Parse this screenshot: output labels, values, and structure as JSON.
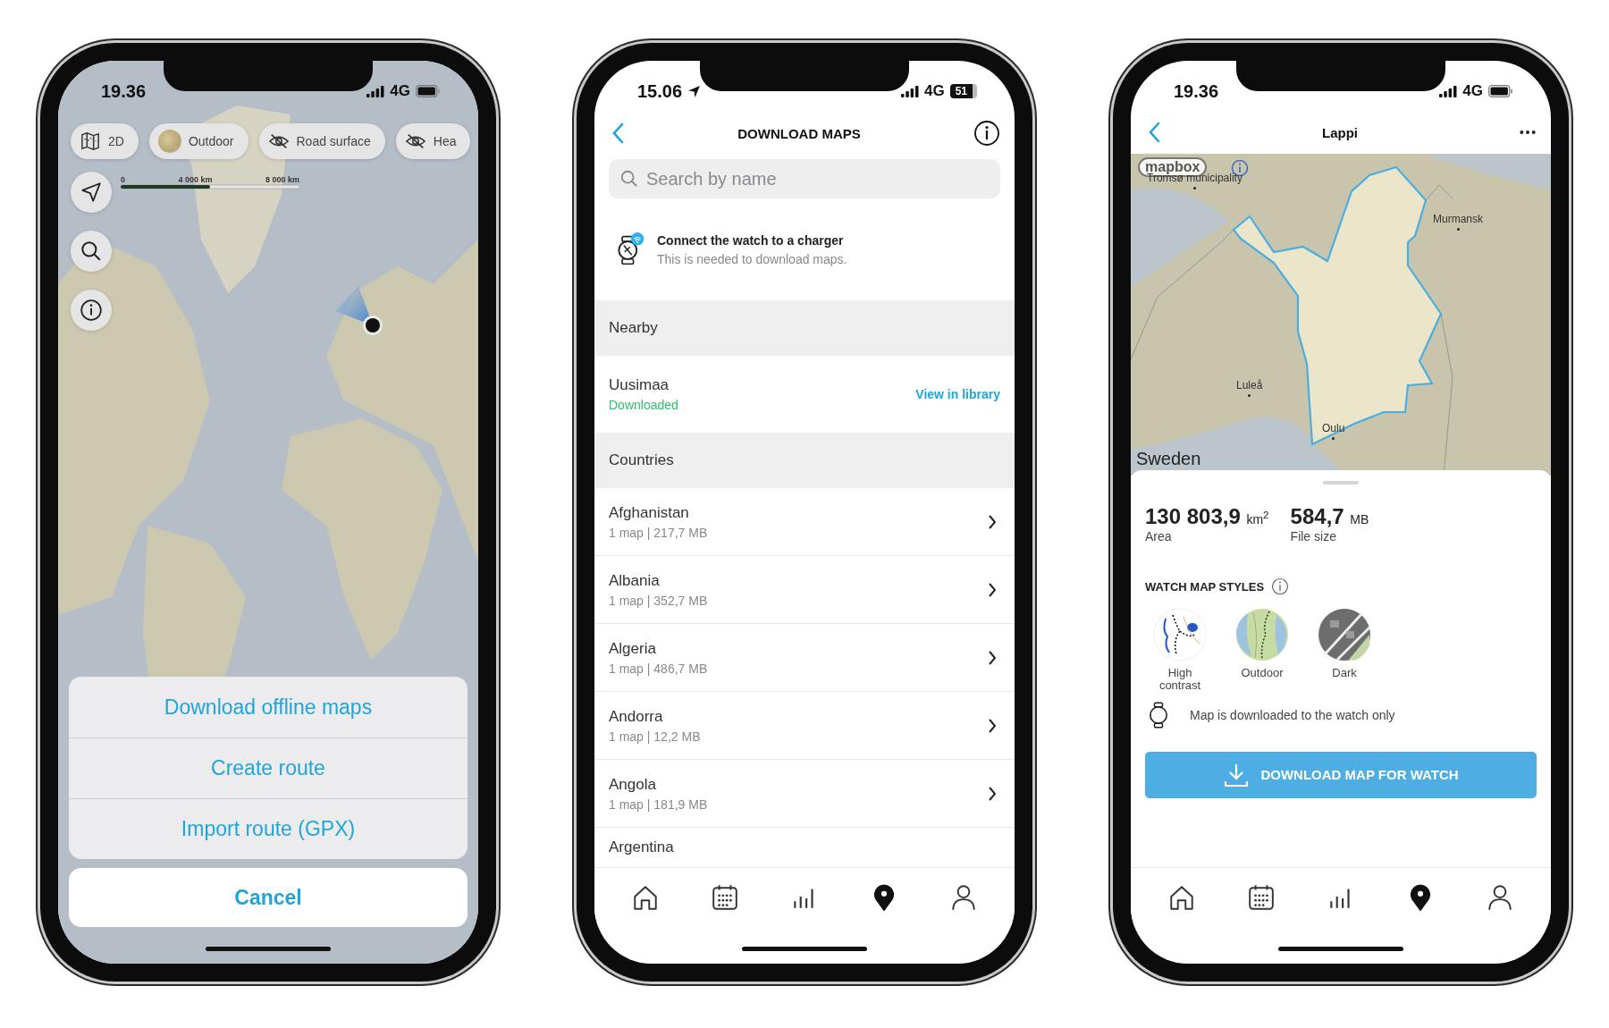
{
  "map_screen": {
    "status_bar": {
      "time": "19.36",
      "network": "4G"
    },
    "chips": [
      {
        "kind": "map",
        "label": "2D"
      },
      {
        "kind": "style",
        "label": "Outdoor"
      },
      {
        "kind": "hidden",
        "label": "Road surface"
      },
      {
        "kind": "hidden",
        "label": "Hea"
      }
    ],
    "scale_bar": {
      "labels": [
        "0",
        "4 000 km",
        "8 000 km"
      ]
    },
    "action_sheet": {
      "actions": [
        "Download offline maps",
        "Create route",
        "Import route (GPX)"
      ],
      "cancel": "Cancel"
    }
  },
  "download_screen": {
    "status_bar": {
      "time": "15.06",
      "network": "4G",
      "location": true,
      "battery_text": "51"
    },
    "title": "DOWNLOAD MAPS",
    "search": {
      "placeholder": "Search by name"
    },
    "notice": {
      "title": "Connect the watch to a charger",
      "text": "This is needed to download maps."
    },
    "sections": [
      {
        "header": "Nearby",
        "rows": [
          {
            "kind": "downloaded",
            "name": "Uusimaa",
            "status": "Downloaded",
            "action": "View in library"
          }
        ]
      },
      {
        "header": "Countries",
        "rows": [
          {
            "kind": "country",
            "name": "Afghanistan",
            "detail": "1 map | 217,7 MB"
          },
          {
            "kind": "country",
            "name": "Albania",
            "detail": "1 map | 352,7 MB"
          },
          {
            "kind": "country",
            "name": "Algeria",
            "detail": "1 map | 486,7 MB"
          },
          {
            "kind": "country",
            "name": "Andorra",
            "detail": "1 map | 12,2 MB"
          },
          {
            "kind": "country",
            "name": "Angola",
            "detail": "1 map | 181,9 MB"
          },
          {
            "kind": "country",
            "name": "Argentina"
          }
        ]
      }
    ],
    "tab_bar": [
      {
        "kind": "home",
        "selected": false
      },
      {
        "kind": "calendar",
        "selected": false
      },
      {
        "kind": "stats",
        "selected": false
      },
      {
        "kind": "map",
        "selected": true
      },
      {
        "kind": "profile",
        "selected": false
      }
    ]
  },
  "region_screen": {
    "status_bar": {
      "time": "19.36",
      "network": "4G"
    },
    "title": "Lappi",
    "map": {
      "attribution": "mapbox",
      "labels": [
        {
          "kind": "city",
          "text": "Tromsø municipality"
        },
        {
          "kind": "city",
          "text": "Murmansk"
        },
        {
          "kind": "city",
          "text": "Luleå"
        },
        {
          "kind": "city",
          "text": "Oulu"
        },
        {
          "kind": "country",
          "text": "Sweden"
        }
      ]
    },
    "stats": [
      {
        "value": "130 803,9",
        "unit": "km$^{2}$",
        "label": "Area"
      },
      {
        "value": "584,7",
        "unit": "MB",
        "label": "File size"
      }
    ],
    "styles_title": "WATCH MAP STYLES",
    "styles": [
      {
        "kind": "high_contrast",
        "label": "High contrast"
      },
      {
        "kind": "outdoor",
        "label": "Outdoor"
      },
      {
        "kind": "dark",
        "label": "Dark"
      }
    ],
    "note": "Map is downloaded to the watch only",
    "button": "DOWNLOAD MAP FOR WATCH",
    "tab_bar": [
      {
        "kind": "home",
        "selected": false
      },
      {
        "kind": "calendar",
        "selected": false
      },
      {
        "kind": "stats",
        "selected": false
      },
      {
        "kind": "map",
        "selected": true
      },
      {
        "kind": "profile",
        "selected": false
      }
    ]
  }
}
